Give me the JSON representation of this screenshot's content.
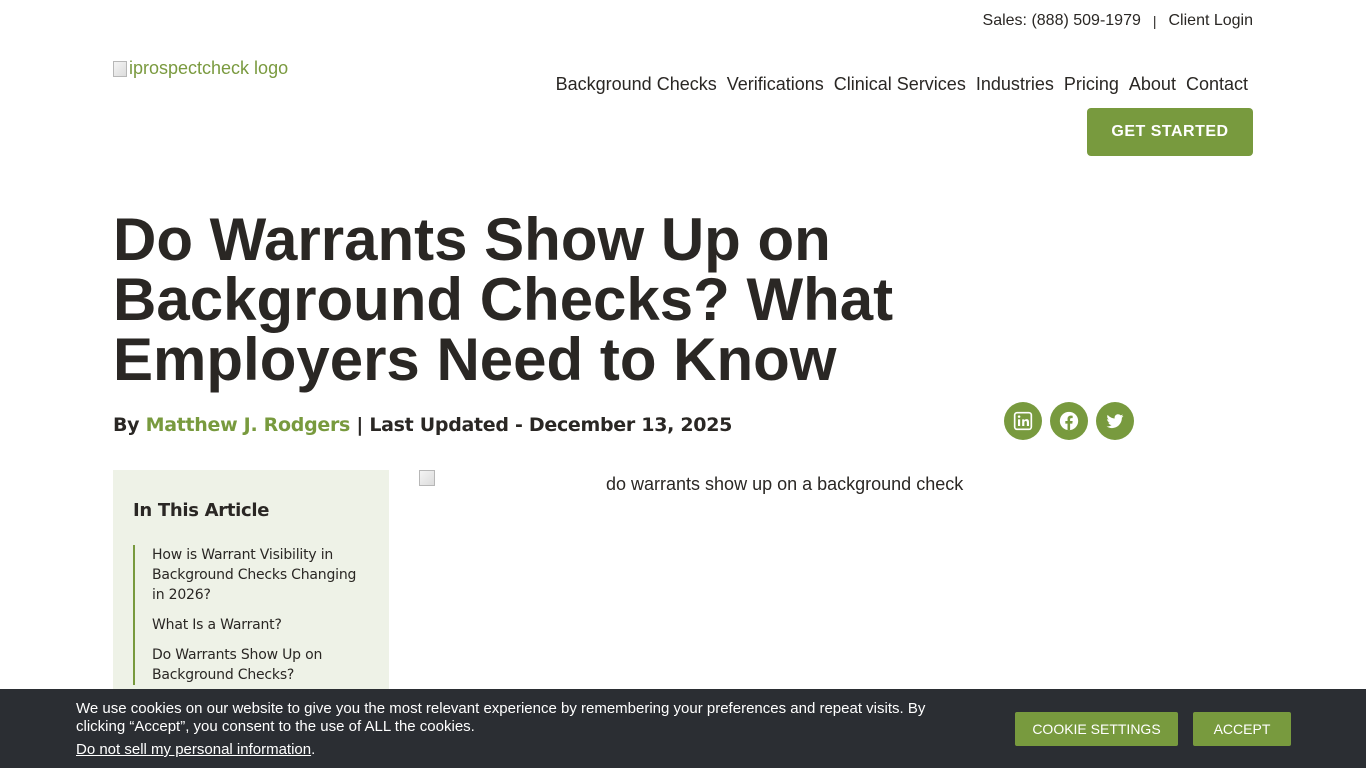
{
  "topbar": {
    "sales": "Sales: (888) 509-1979",
    "separator": "|",
    "client_login": "Client Login"
  },
  "logo": {
    "alt": "iprospectcheck logo"
  },
  "nav": {
    "items": [
      "Background Checks",
      "Verifications",
      "Clinical Services",
      "Industries",
      "Pricing",
      "About",
      "Contact"
    ],
    "cta": "GET STARTED"
  },
  "article": {
    "title": "Do Warrants Show Up on Background Checks? What Employers Need to Know",
    "by": "By",
    "author": "Matthew J. Rodgers",
    "updated": "| Last Updated - December 13, 2025",
    "image_alt": "do warrants show up on a background check"
  },
  "share": {
    "icons": [
      "linkedin-icon",
      "facebook-icon",
      "twitter-icon"
    ]
  },
  "toc": {
    "title": "In This Article",
    "items": [
      "How is Warrant Visibility in Background Checks Changing in 2026?",
      "What Is a Warrant?",
      "Do Warrants Show Up on Background Checks?"
    ]
  },
  "cookie": {
    "message": "We use cookies on our website to give you the most relevant experience by remembering your preferences and repeat visits. By clicking “Accept”, you consent to the use of ALL the cookies.",
    "do_not_sell": "Do not sell my personal information",
    "do_not_sell_suffix": ".",
    "settings": "COOKIE SETTINGS",
    "accept": "ACCEPT"
  },
  "colors": {
    "brand": "#789a3e",
    "text": "#2a2724",
    "toc_bg": "#eef2e7",
    "cookie_bg": "#2b2e33"
  }
}
